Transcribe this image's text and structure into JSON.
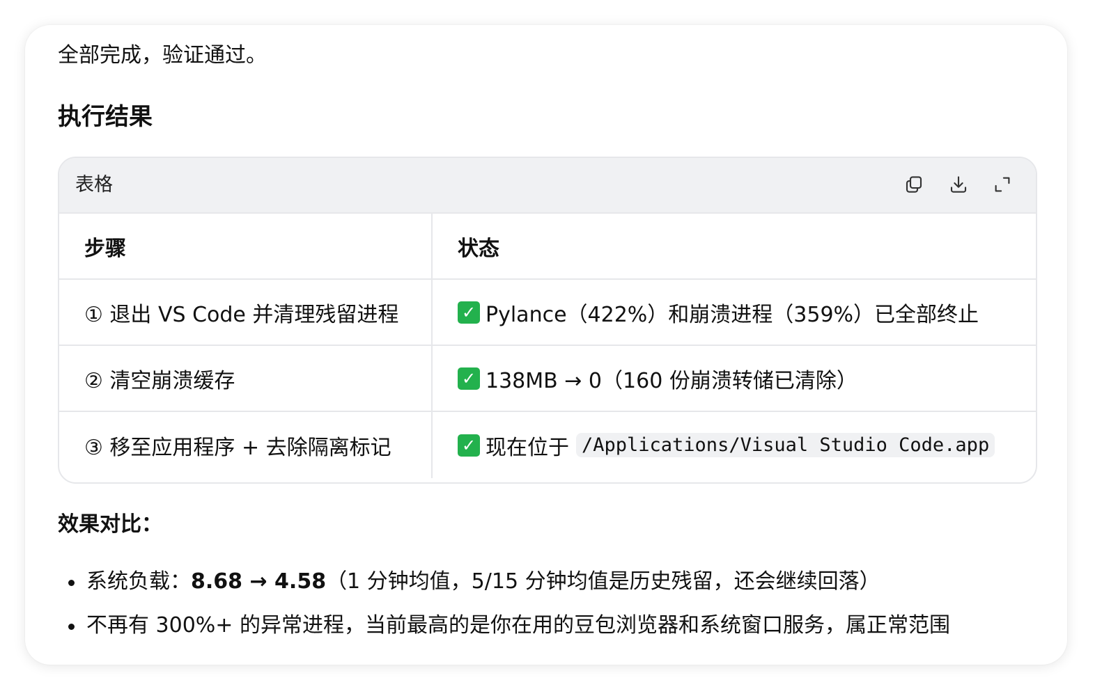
{
  "intro_text": "全部完成，验证通过。",
  "section_title": "执行结果",
  "table": {
    "title": "表格",
    "toolbar": {
      "copy_icon": "copy-icon",
      "download_icon": "download-icon",
      "expand_icon": "expand-icon"
    },
    "headers": [
      "步骤",
      "状态"
    ],
    "rows": [
      {
        "step": "① 退出 VS Code 并清理残留进程",
        "check": "✓",
        "status": "Pylance（422%）和崩溃进程（359%）已全部终止",
        "code": ""
      },
      {
        "step": "② 清空崩溃缓存",
        "check": "✓",
        "status": "138MB → 0（160 份崩溃转储已清除）",
        "code": ""
      },
      {
        "step": "③ 移至应用程序 + 去除隔离标记",
        "check": "✓",
        "status": "现在位于",
        "code": "/Applications/Visual Studio Code.app"
      }
    ]
  },
  "compare_title": "效果对比：",
  "bullets": [
    {
      "prefix": "系统负载：",
      "strong": "8.68 → 4.58",
      "suffix": "（1 分钟均值，5/15 分钟均值是历史残留，还会继续回落）"
    },
    {
      "prefix": "不再有 300%+ 的异常进程，当前最高的是你在用的豆包浏览器和系统窗口服务，属正常范围",
      "strong": "",
      "suffix": ""
    }
  ],
  "colors": {
    "check_green": "#23b14d",
    "header_bg": "#f0f1f3",
    "border": "#e6e7ea"
  }
}
